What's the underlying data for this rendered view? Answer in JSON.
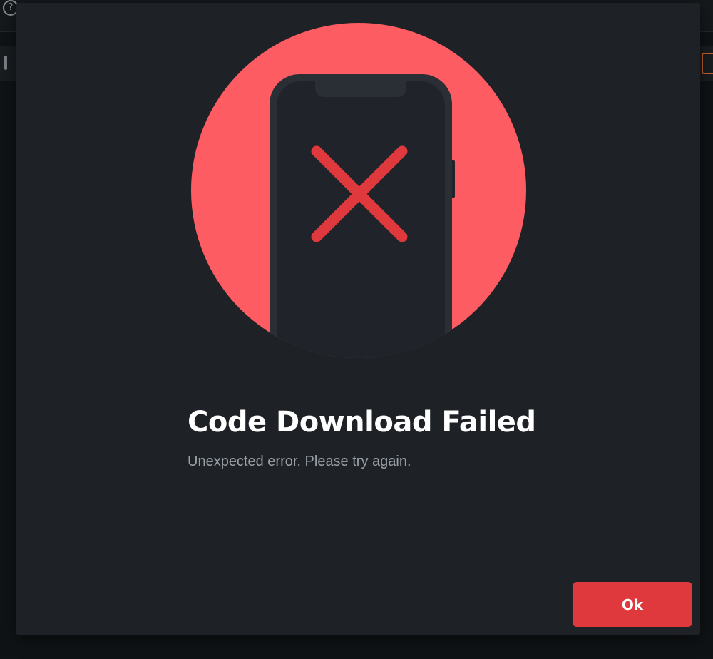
{
  "dialog": {
    "title": "Code Download Failed",
    "message": "Unexpected error. Please try again.",
    "ok_label": "Ok"
  },
  "icons": {
    "illustration": "phone-error-icon",
    "error_mark": "close-x-icon",
    "background_help": "help-circle-icon"
  },
  "colors": {
    "modal_background": "#1e2226",
    "circle": "#fd5c62",
    "phone_body": "#20242a",
    "phone_bezel": "#2a2f36",
    "error_mark": "#e0393d",
    "ok_button": "#e0393d",
    "title_text": "#ffffff",
    "message_text": "#9aa0a8"
  }
}
